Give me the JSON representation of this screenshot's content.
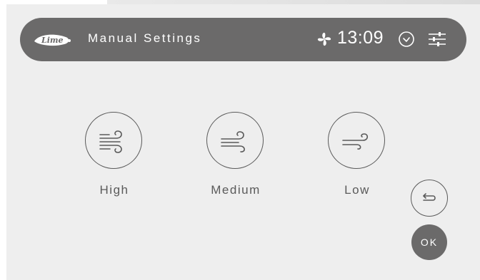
{
  "header": {
    "logo_text": "Lime",
    "title": "Manual Settings",
    "time": "13:09",
    "fan_icon": "fan-icon",
    "clock_icon": "clock-icon",
    "settings_icon": "sliders-icon"
  },
  "speeds": [
    {
      "label": "High",
      "icon": "wind-high-icon"
    },
    {
      "label": "Medium",
      "icon": "wind-medium-icon"
    },
    {
      "label": "Low",
      "icon": "wind-low-icon"
    }
  ],
  "actions": {
    "back_icon": "return-icon",
    "ok_label": "OK"
  },
  "colors": {
    "header_bg": "#6b6a6a",
    "screen_bg": "#eeeeee",
    "line": "#5a5a5a",
    "text_light": "#ffffff"
  }
}
